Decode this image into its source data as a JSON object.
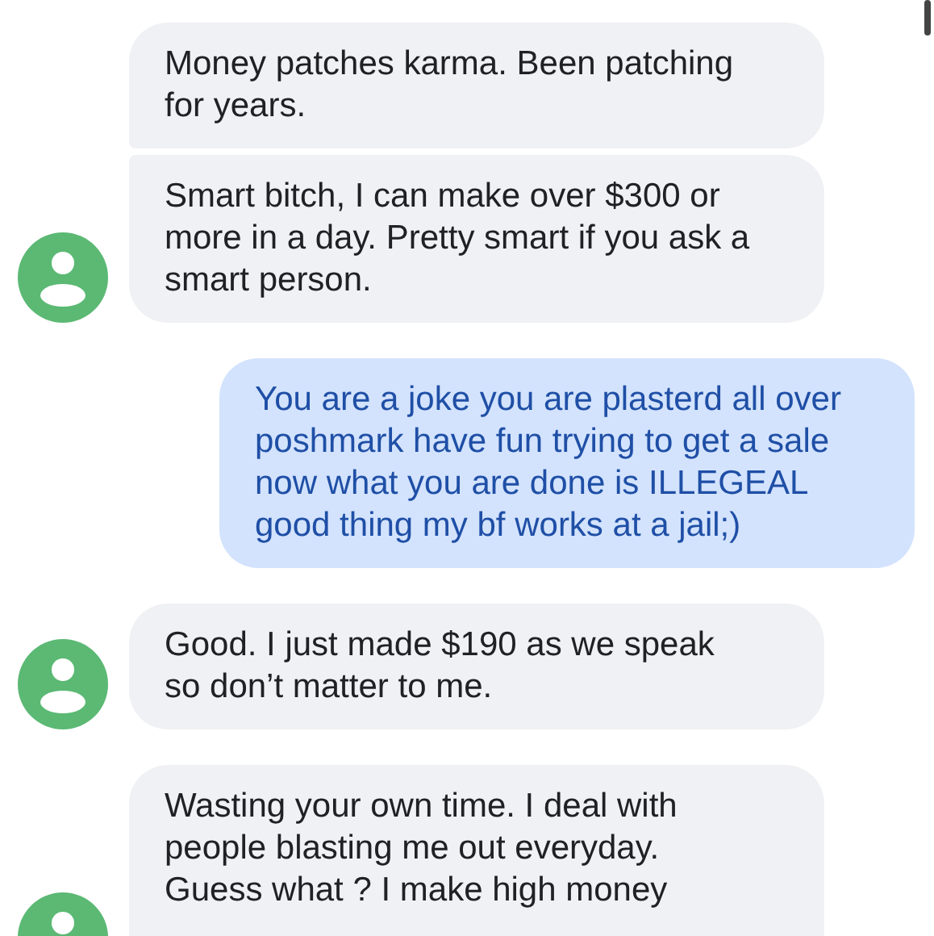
{
  "conversation": [
    {
      "kind": "incoming",
      "messages": [
        "Money patches karma. Been patching\nfor years.",
        "Smart bitch, I can make over $300 or\nmore in a day. Pretty smart if you ask a\nsmart person."
      ]
    },
    {
      "kind": "outgoing",
      "messages": [
        "You are a joke you are plasterd all over\nposhmark have fun trying to get a sale\nnow what you are done is ILLEGEAL\ngood thing my bf works at a jail;)"
      ]
    },
    {
      "kind": "incoming",
      "messages": [
        "Good. I just made $190 as we speak\nso don’t matter to me."
      ]
    },
    {
      "kind": "incoming",
      "messages": [
        "Wasting your own time. I deal with\npeople blasting me out everyday.\nGuess what ? I make high money"
      ]
    }
  ]
}
